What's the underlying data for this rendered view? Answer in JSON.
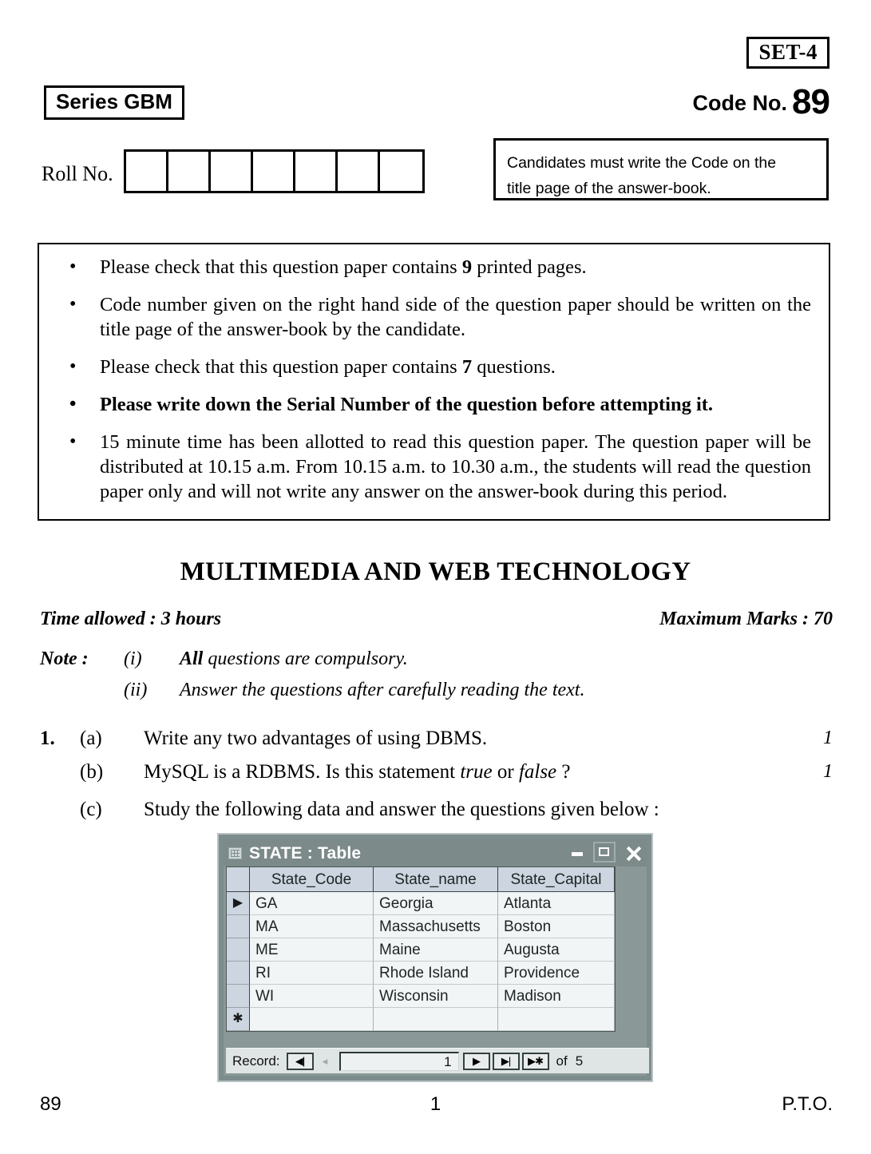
{
  "header": {
    "set_label": "SET-4",
    "series_label": "Series GBM",
    "code_label": "Code No.",
    "code_number": "89"
  },
  "roll_no": {
    "label": "Roll No.",
    "cell_count": 7,
    "cells": [
      "",
      "",
      "",
      "",
      "",
      "",
      ""
    ]
  },
  "candidate_note": {
    "line1": "Candidates must write the Code on the",
    "line2": "title page of the answer-book."
  },
  "instructions": {
    "bullet": "•",
    "items": [
      {
        "pre": "Please check that this question paper contains ",
        "strong": "9",
        "post": " printed pages.",
        "bold": false
      },
      {
        "pre": "Code number given on the right hand side of the question paper should be written on the title page of the answer-book by the candidate.",
        "strong": "",
        "post": "",
        "bold": false
      },
      {
        "pre": "Please check that this question paper contains ",
        "strong": "7",
        "post": " questions.",
        "bold": false
      },
      {
        "pre": "Please write down the Serial Number of the question before attempting it.",
        "strong": "",
        "post": "",
        "bold": true
      },
      {
        "pre": "15 minute time has been allotted to read this question paper. The question paper will be distributed at 10.15 a.m. From 10.15 a.m. to 10.30 a.m., the students will read the question paper only and will not write any answer on the answer-book during this period.",
        "strong": "",
        "post": "",
        "bold": false
      }
    ]
  },
  "paper": {
    "title": "MULTIMEDIA AND WEB TECHNOLOGY",
    "time_allowed": "Time allowed : 3 hours",
    "maximum_marks": "Maximum Marks : 70"
  },
  "note": {
    "label": "Note :",
    "items": [
      {
        "roman": "(i)",
        "bold_lead": "All",
        "text": " questions are compulsory."
      },
      {
        "roman": "(ii)",
        "bold_lead": "",
        "text": "Answer the questions after carefully reading the text."
      }
    ]
  },
  "question1": {
    "number": "1.",
    "parts": [
      {
        "label": "(a)",
        "text": "Write any two advantages of using DBMS.",
        "marks": "1"
      },
      {
        "label": "(b)",
        "text_pre": "MySQL is a RDBMS. Is this statement ",
        "italic1": "true",
        "text_mid": " or ",
        "italic2": "false",
        "text_post": " ?",
        "marks": "1"
      },
      {
        "label": "(c)",
        "text": "Study the following data and answer the questions given below :",
        "marks": ""
      }
    ]
  },
  "access_table": {
    "window_title": "STATE : Table",
    "title_icon": "table-grid-icon",
    "buttons": {
      "minimize": "minimize-icon",
      "maximize": "restore-icon",
      "close": "close-icon"
    },
    "current_row_marker": "▶",
    "new_row_marker": "✱",
    "columns": [
      "State_Code",
      "State_name",
      "State_Capital"
    ],
    "rows": [
      [
        "GA",
        "Georgia",
        "Atlanta"
      ],
      [
        "MA",
        "Massachusetts",
        "Boston"
      ],
      [
        "ME",
        "Maine",
        "Augusta"
      ],
      [
        "RI",
        "Rhode Island",
        "Providence"
      ],
      [
        "WI",
        "Wisconsin",
        "Madison"
      ]
    ],
    "navigator": {
      "label": "Record:",
      "first": "◀|",
      "previous": "◂",
      "value": "1",
      "next": "▶",
      "last": "▶|",
      "new": "▶✱",
      "of_label": "of",
      "total": "5"
    }
  },
  "footer": {
    "left": "89",
    "center": "1",
    "right": "P.T.O."
  }
}
